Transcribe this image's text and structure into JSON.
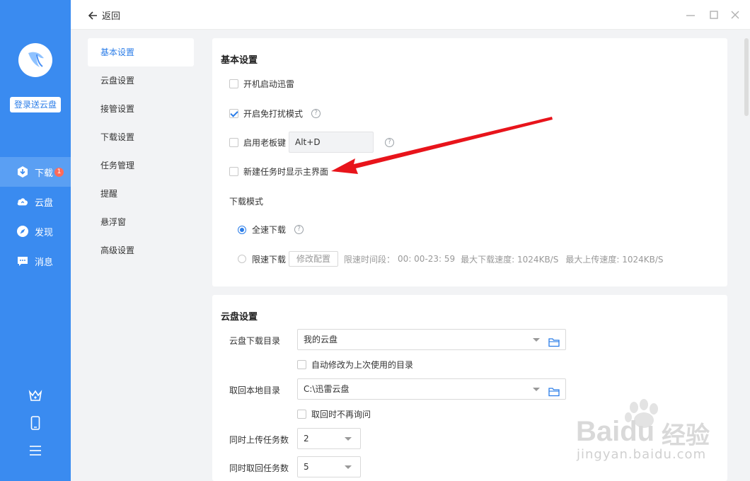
{
  "sidebar": {
    "login_label": "登录送云盘",
    "nav": [
      {
        "label": "下载",
        "icon": "download-icon",
        "badge": "1",
        "active": true
      },
      {
        "label": "云盘",
        "icon": "cloud-icon"
      },
      {
        "label": "发现",
        "icon": "compass-icon"
      },
      {
        "label": "消息",
        "icon": "message-icon"
      }
    ],
    "bottom_icons": [
      "crown-icon",
      "phone-icon",
      "menu-icon"
    ]
  },
  "topbar": {
    "back_label": "返回",
    "window_controls": [
      "minimize-icon",
      "maximize-icon",
      "close-icon"
    ]
  },
  "settings_nav": [
    {
      "label": "基本设置",
      "active": true
    },
    {
      "label": "云盘设置"
    },
    {
      "label": "接管设置"
    },
    {
      "label": "下载设置"
    },
    {
      "label": "任务管理"
    },
    {
      "label": "提醒"
    },
    {
      "label": "悬浮窗"
    },
    {
      "label": "高级设置"
    }
  ],
  "basic": {
    "title": "基本设置",
    "autostart": {
      "label": "开机启动迅雷",
      "checked": false
    },
    "dnd": {
      "label": "开启免打扰模式",
      "checked": true
    },
    "bosskey": {
      "label": "启用老板键",
      "checked": false,
      "value": "Alt+D"
    },
    "show_main": {
      "label": "新建任务时显示主界面",
      "checked": false
    },
    "mode_title": "下载模式",
    "full_speed": {
      "label": "全速下载",
      "selected": true
    },
    "limited": {
      "label": "限速下载",
      "selected": false,
      "modify_btn": "修改配置",
      "time_label": "限速时间段：",
      "time_value": "00: 00-23: 59",
      "max_down": "最大下载速度: 1024KB/S",
      "max_up": "最大上传速度: 1024KB/S"
    }
  },
  "cloud": {
    "title": "云盘设置",
    "download_dir": {
      "label": "云盘下载目录",
      "value": "我的云盘"
    },
    "auto_modify": {
      "label": "自动修改为上次使用的目录",
      "checked": false
    },
    "local_dir": {
      "label": "取回本地目录",
      "value": "C:\\迅雷云盘"
    },
    "no_ask": {
      "label": "取回时不再询问",
      "checked": false
    },
    "upload_tasks": {
      "label": "同时上传任务数",
      "value": "2"
    },
    "fetch_tasks": {
      "label": "同时取回任务数",
      "value": "5"
    }
  },
  "watermark": {
    "brand": "Baidu",
    "cn": "经验",
    "url": "jingyan.baidu.com"
  },
  "colors": {
    "accent": "#2b7de8",
    "sidebar": "#3a8bf0",
    "annotation": "#e8141b"
  }
}
